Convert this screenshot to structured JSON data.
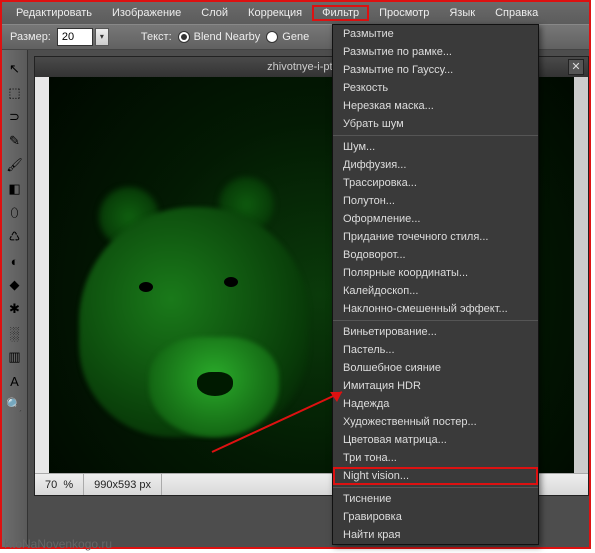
{
  "menubar": {
    "items": [
      {
        "label": "Редактировать"
      },
      {
        "label": "Изображение"
      },
      {
        "label": "Слой"
      },
      {
        "label": "Коррекция"
      },
      {
        "label": "Фильтр",
        "highlight": true
      },
      {
        "label": "Просмотр"
      },
      {
        "label": "Язык"
      },
      {
        "label": "Справка"
      }
    ]
  },
  "toolbar": {
    "size_label": "Размер:",
    "size_value": "20",
    "text_label": "Текст:",
    "radio1": "Blend Nearby",
    "radio2": "Gene"
  },
  "tools": [
    {
      "icon": "↖",
      "name": "move-tool"
    },
    {
      "icon": "⬚",
      "name": "marquee-tool"
    },
    {
      "icon": "⊃",
      "name": "lasso-tool"
    },
    {
      "icon": "✎",
      "name": "pencil-tool"
    },
    {
      "icon": "🖌",
      "name": "brush-tool"
    },
    {
      "icon": "◧",
      "name": "gradient-tool"
    },
    {
      "icon": "⬯",
      "name": "stamp-tool"
    },
    {
      "icon": "♺",
      "name": "clone-tool"
    },
    {
      "icon": "◐",
      "name": "dodge-tool"
    },
    {
      "icon": "◆",
      "name": "shape-tool"
    },
    {
      "icon": "✱",
      "name": "sparkle-tool"
    },
    {
      "icon": "░",
      "name": "pattern-tool"
    },
    {
      "icon": "▥",
      "name": "fill-tool"
    },
    {
      "icon": "A",
      "name": "text-tool"
    },
    {
      "icon": "🔍",
      "name": "zoom-tool"
    }
  ],
  "document": {
    "title": "zhivotnye-i-ptitcy-f"
  },
  "filter_menu": {
    "groups": [
      [
        "Размытие",
        "Размытие по рамке...",
        "Размытие по Гауссу...",
        "Резкость",
        "Нерезкая маска...",
        "Убрать шум"
      ],
      [
        "Шум...",
        "Диффузия...",
        "Трассировка...",
        "Полутон...",
        "Оформление...",
        "Придание точечного стиля...",
        "Водоворот...",
        "Полярные координаты...",
        "Калейдоскоп...",
        "Наклонно-смешенный эффект..."
      ],
      [
        "Виньетирование...",
        "Пастель...",
        "Волшебное сияние",
        "Имитация HDR",
        "Надежда",
        "Художественный постер...",
        "Цветовая матрица...",
        "Три тона...",
        "Night vision..."
      ],
      [
        "Тиснение",
        "Гравировка",
        "Найти края"
      ]
    ],
    "highlight_item": "Night vision..."
  },
  "statusbar": {
    "zoom": "70",
    "zoom_unit": "%",
    "dims": "990x593 px"
  },
  "watermark": "KtoNaNovenkogo.ru"
}
